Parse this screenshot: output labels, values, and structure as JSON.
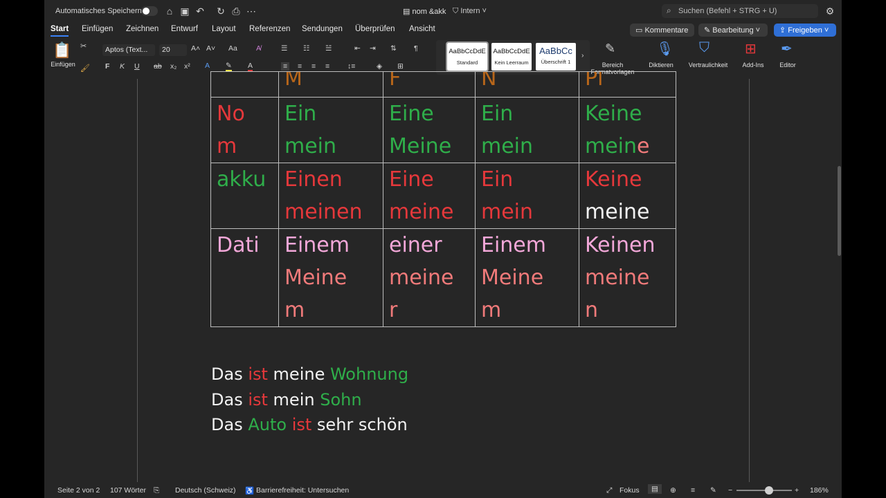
{
  "titlebar": {
    "autosave_label": "Automatisches Speichern",
    "doc_title": "nom &akk",
    "sensitivity": "Intern",
    "search_placeholder": "Suchen (Befehl + STRG + U)"
  },
  "tabs": [
    "Start",
    "Einfügen",
    "Zeichnen",
    "Entwurf",
    "Layout",
    "Referenzen",
    "Sendungen",
    "Überprüfen",
    "Ansicht"
  ],
  "actions": {
    "comments": "Kommentare",
    "editing": "Bearbeitung",
    "share": "Freigeben"
  },
  "ribbon": {
    "paste": "Einfügen",
    "font_name": "Aptos (Text...",
    "font_size": "20",
    "bold": "F",
    "italic": "K",
    "underline": "U",
    "strike": "ab",
    "sub": "x₂",
    "sup": "x²",
    "styles": [
      {
        "preview": "AaBbCcDdE",
        "name": "Standard"
      },
      {
        "preview": "AaBbCcDdE",
        "name": "Kein Leerraum"
      },
      {
        "preview": "AaBbCc",
        "name": "Überschrift 1"
      }
    ],
    "styles_pane": "Bereich\nFormatvorlagen",
    "dictate": "Diktieren",
    "sensitivity": "Vertraulichkeit",
    "addins": "Add-Ins",
    "editor": "Editor"
  },
  "table": {
    "header": [
      "",
      "M",
      "F",
      "N",
      "Pl"
    ],
    "rows": [
      {
        "label": [
          "No",
          "m"
        ],
        "cells": [
          [
            "Ein",
            "mein"
          ],
          [
            "Eine",
            "Meine"
          ],
          [
            "Ein",
            "mein"
          ],
          [
            "Keine",
            "mein",
            "e"
          ]
        ]
      },
      {
        "label": [
          "akku"
        ],
        "cells": [
          [
            "Einen",
            "meinen"
          ],
          [
            "Eine",
            "meine"
          ],
          [
            "Ein",
            "mein"
          ],
          [
            "Keine",
            "meine"
          ]
        ]
      },
      {
        "label": [
          "Dati"
        ],
        "cells": [
          [
            "Einem",
            "Meine",
            "m"
          ],
          [
            "einer",
            "meine",
            "r"
          ],
          [
            "Einem",
            "Meine",
            "m"
          ],
          [
            "Keinen",
            "meine",
            "n"
          ]
        ]
      }
    ]
  },
  "sentences": [
    [
      "Das ",
      "ist",
      " meine ",
      "Wohnung"
    ],
    [
      "Das ",
      "ist",
      " mein ",
      "Sohn"
    ],
    [
      "Das ",
      "Auto",
      " ",
      "ist",
      " sehr schön"
    ]
  ],
  "statusbar": {
    "page": "Seite 2 von 2",
    "words": "107 Wörter",
    "language": "Deutsch (Schweiz)",
    "accessibility": "Barrierefreiheit: Untersuchen",
    "focus": "Fokus",
    "zoom": "186%"
  }
}
